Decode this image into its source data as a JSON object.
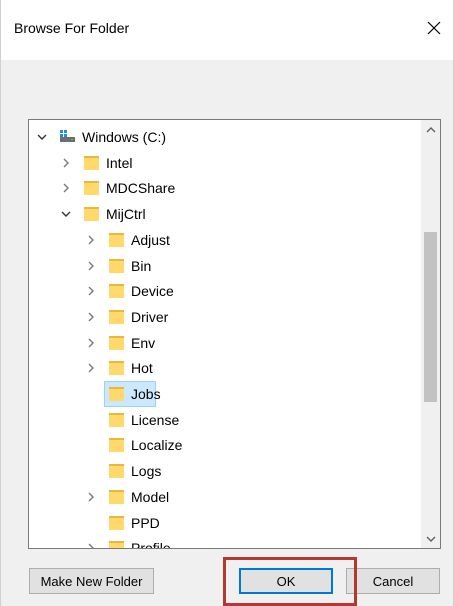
{
  "dialog": {
    "title": "Browse For Folder",
    "close_icon": "close-icon",
    "close_glyph": "✕"
  },
  "tree": {
    "items": [
      {
        "label": "Windows (C:)",
        "level": 0,
        "expander": "expanded",
        "icon": "drive-icon"
      },
      {
        "label": "Intel",
        "level": 1,
        "expander": "collapsed",
        "icon": "folder-icon"
      },
      {
        "label": "MDCShare",
        "level": 1,
        "expander": "collapsed",
        "icon": "folder-icon"
      },
      {
        "label": "MijCtrl",
        "level": 1,
        "expander": "expanded",
        "icon": "folder-icon"
      },
      {
        "label": "Adjust",
        "level": 2,
        "expander": "collapsed",
        "icon": "folder-icon"
      },
      {
        "label": "Bin",
        "level": 2,
        "expander": "collapsed",
        "icon": "folder-icon"
      },
      {
        "label": "Device",
        "level": 2,
        "expander": "collapsed",
        "icon": "folder-icon"
      },
      {
        "label": "Driver",
        "level": 2,
        "expander": "collapsed",
        "icon": "folder-icon"
      },
      {
        "label": "Env",
        "level": 2,
        "expander": "collapsed",
        "icon": "folder-icon"
      },
      {
        "label": "Hot",
        "level": 2,
        "expander": "collapsed",
        "icon": "folder-icon"
      },
      {
        "label": "Jobs",
        "level": 2,
        "expander": "none",
        "icon": "folder-icon",
        "selected": true
      },
      {
        "label": "License",
        "level": 2,
        "expander": "none",
        "icon": "folder-icon"
      },
      {
        "label": "Localize",
        "level": 2,
        "expander": "none",
        "icon": "folder-icon"
      },
      {
        "label": "Logs",
        "level": 2,
        "expander": "none",
        "icon": "folder-icon"
      },
      {
        "label": "Model",
        "level": 2,
        "expander": "collapsed",
        "icon": "folder-icon"
      },
      {
        "label": "PPD",
        "level": 2,
        "expander": "none",
        "icon": "folder-icon"
      },
      {
        "label": "Profile",
        "level": 2,
        "expander": "collapsed",
        "icon": "folder-icon"
      }
    ],
    "scroll_up_icon": "chevron-up-icon",
    "scroll_down_icon": "chevron-down-icon"
  },
  "buttons": {
    "make_new_folder": "Make New Folder",
    "ok": "OK",
    "cancel": "Cancel"
  },
  "colors": {
    "folder": "#ffd96b",
    "folder_dark": "#e8b83a",
    "selection": "#cce8ff",
    "highlight_box": "#b5382f",
    "ok_border": "#0078d7"
  }
}
